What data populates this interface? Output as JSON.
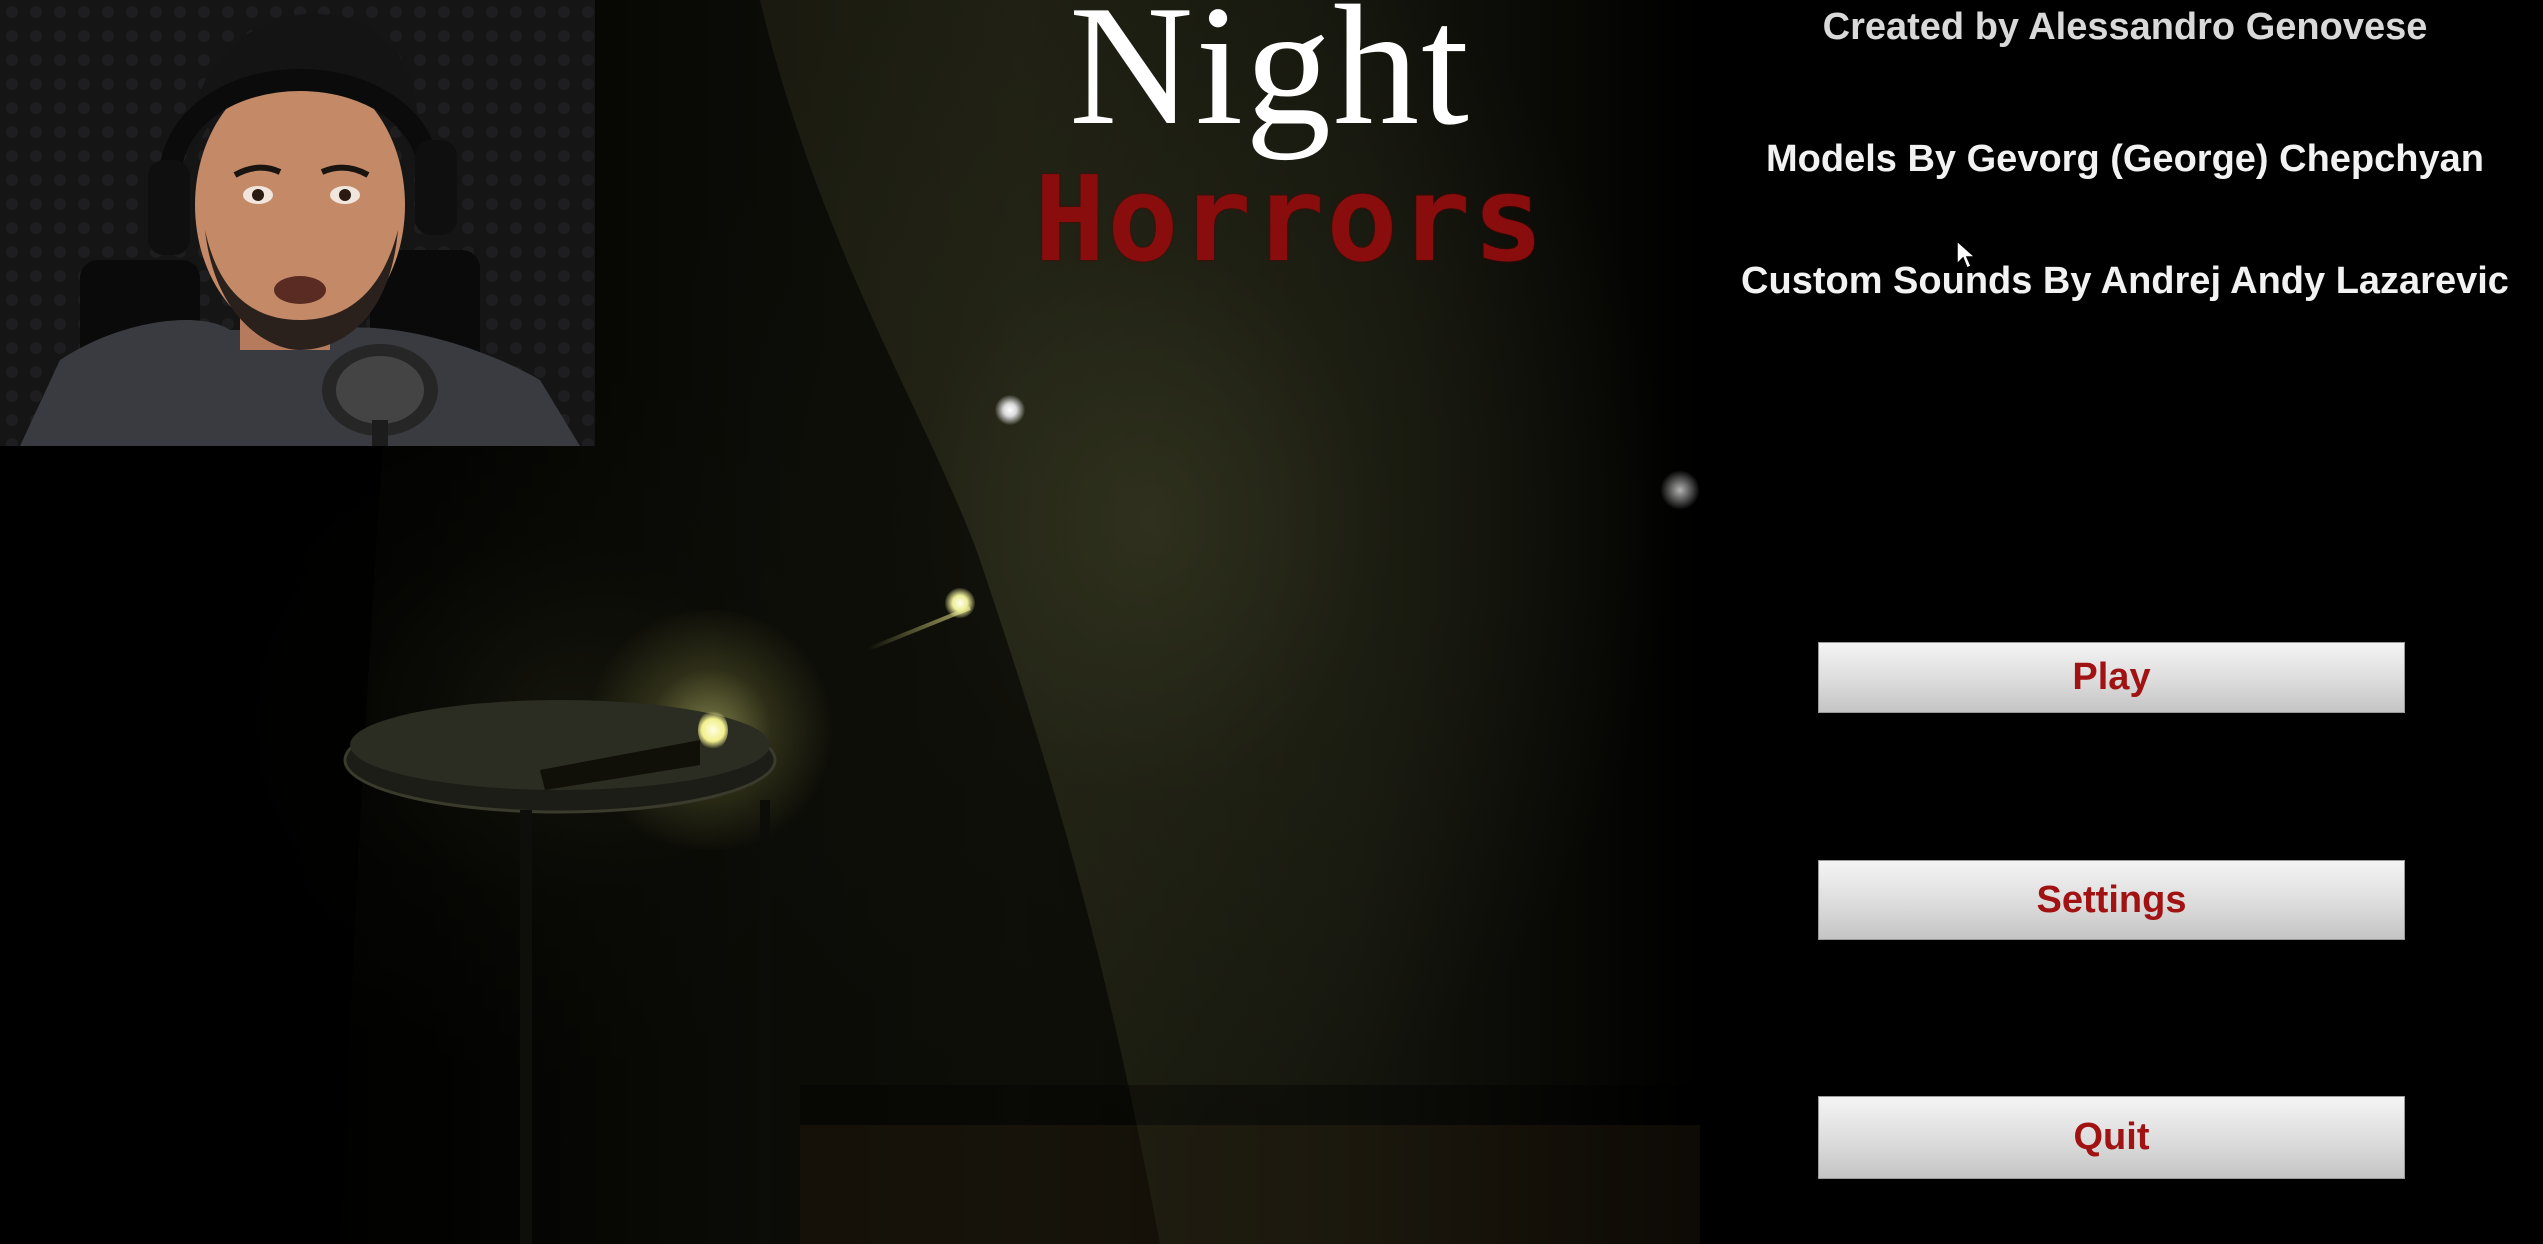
{
  "title": {
    "line1": "Night",
    "line2": "Horrors"
  },
  "credits": {
    "created": "Created by Alessandro Genovese",
    "models": "Models By Gevorg (George) Chepchyan",
    "sounds": "Custom Sounds By Andrej Andy Lazarevic"
  },
  "menu": {
    "play": "Play",
    "settings": "Settings",
    "quit": "Quit"
  },
  "colors": {
    "title_red": "#8a0d0d",
    "button_text": "#a11212",
    "button_face": "#dcdcdc"
  },
  "icons": {
    "cursor": "mouse-pointer-icon"
  }
}
